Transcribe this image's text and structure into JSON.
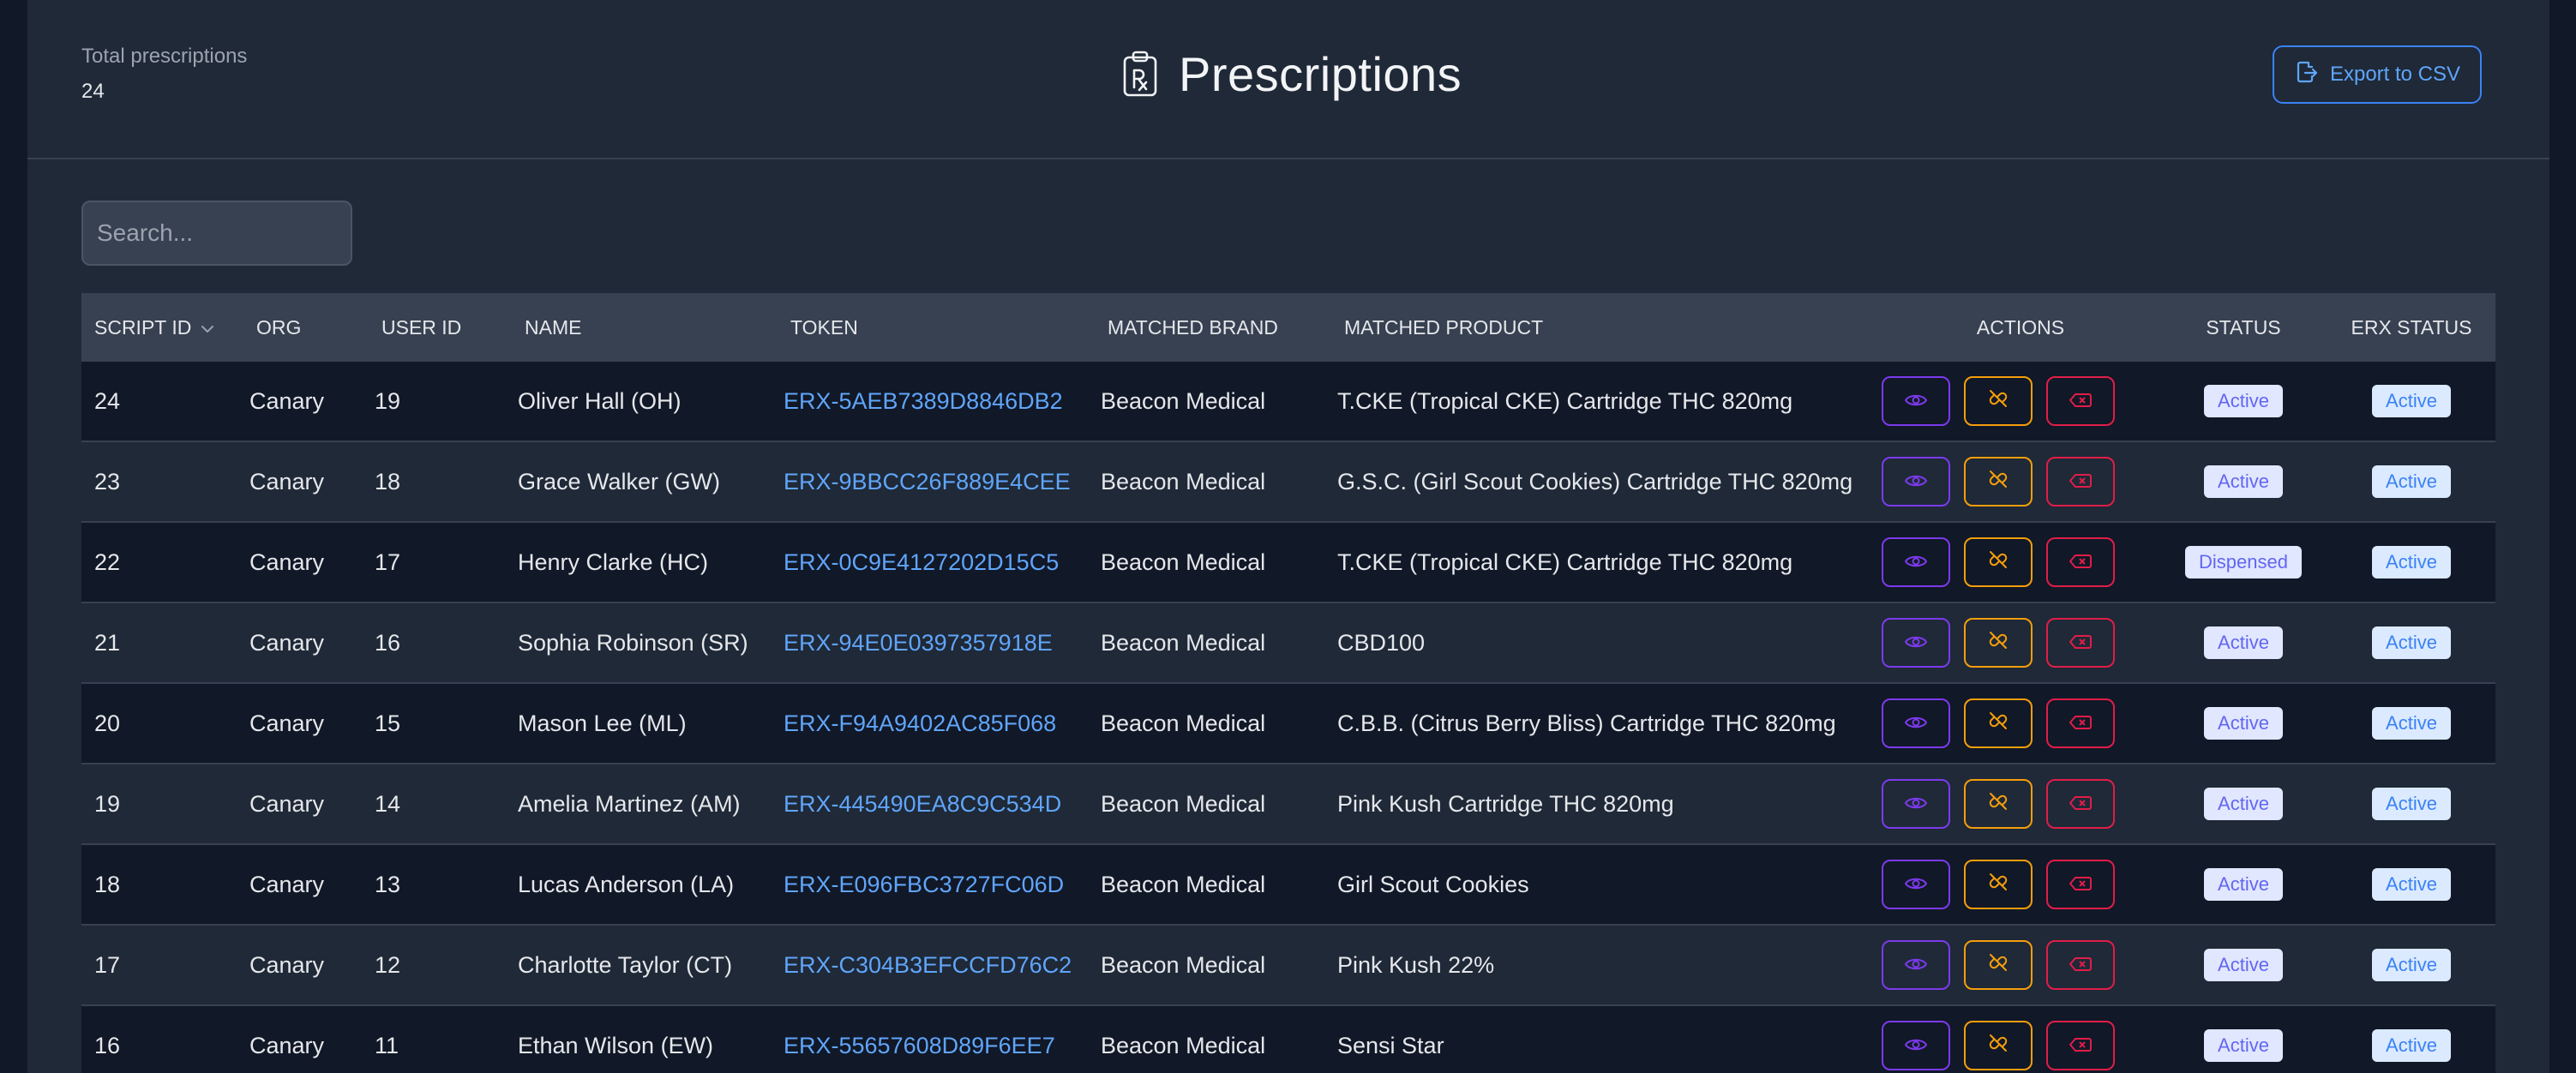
{
  "header": {
    "total_label": "Total prescriptions",
    "total_value": "24",
    "title": "Prescriptions",
    "export_label": "Export to CSV"
  },
  "search": {
    "placeholder": "Search..."
  },
  "table": {
    "columns": {
      "script_id": "SCRIPT ID",
      "org": "ORG",
      "user_id": "USER ID",
      "name": "NAME",
      "token": "TOKEN",
      "brand": "MATCHED BRAND",
      "product": "MATCHED PRODUCT",
      "actions": "ACTIONS",
      "status": "STATUS",
      "erx_status": "ERX STATUS"
    },
    "rows": [
      {
        "id": "24",
        "org": "Canary",
        "user": "19",
        "name": "Oliver Hall (OH)",
        "token": "ERX-5AEB7389D8846DB2",
        "brand": "Beacon Medical",
        "product": "T.CKE (Tropical CKE) Cartridge THC 820mg",
        "status": "Active",
        "erx": "Active"
      },
      {
        "id": "23",
        "org": "Canary",
        "user": "18",
        "name": "Grace Walker (GW)",
        "token": "ERX-9BBCC26F889E4CEE",
        "brand": "Beacon Medical",
        "product": "G.S.C. (Girl Scout Cookies) Cartridge THC 820mg",
        "status": "Active",
        "erx": "Active"
      },
      {
        "id": "22",
        "org": "Canary",
        "user": "17",
        "name": "Henry Clarke (HC)",
        "token": "ERX-0C9E4127202D15C5",
        "brand": "Beacon Medical",
        "product": "T.CKE (Tropical CKE) Cartridge THC 820mg",
        "status": "Dispensed",
        "erx": "Active"
      },
      {
        "id": "21",
        "org": "Canary",
        "user": "16",
        "name": "Sophia Robinson (SR)",
        "token": "ERX-94E0E0397357918E",
        "brand": "Beacon Medical",
        "product": "CBD100",
        "status": "Active",
        "erx": "Active"
      },
      {
        "id": "20",
        "org": "Canary",
        "user": "15",
        "name": "Mason Lee (ML)",
        "token": "ERX-F94A9402AC85F068",
        "brand": "Beacon Medical",
        "product": "C.B.B. (Citrus Berry Bliss) Cartridge THC 820mg",
        "status": "Active",
        "erx": "Active"
      },
      {
        "id": "19",
        "org": "Canary",
        "user": "14",
        "name": "Amelia Martinez (AM)",
        "token": "ERX-445490EA8C9C534D",
        "brand": "Beacon Medical",
        "product": "Pink Kush Cartridge THC 820mg",
        "status": "Active",
        "erx": "Active"
      },
      {
        "id": "18",
        "org": "Canary",
        "user": "13",
        "name": "Lucas Anderson (LA)",
        "token": "ERX-E096FBC3727FC06D",
        "brand": "Beacon Medical",
        "product": "Girl Scout Cookies",
        "status": "Active",
        "erx": "Active"
      },
      {
        "id": "17",
        "org": "Canary",
        "user": "12",
        "name": "Charlotte Taylor (CT)",
        "token": "ERX-C304B3EFCCFD76C2",
        "brand": "Beacon Medical",
        "product": "Pink Kush 22%",
        "status": "Active",
        "erx": "Active"
      },
      {
        "id": "16",
        "org": "Canary",
        "user": "11",
        "name": "Ethan Wilson (EW)",
        "token": "ERX-55657608D89F6EE7",
        "brand": "Beacon Medical",
        "product": "Sensi Star",
        "status": "Active",
        "erx": "Active"
      }
    ]
  },
  "icons": {
    "title": "prescription-clipboard-icon",
    "export": "file-export-icon",
    "sort": "chevron-down-icon",
    "view": "eye-icon",
    "unlink": "unlink-icon",
    "cancel": "cancel-x-icon"
  },
  "colors": {
    "page_bg": "#111827",
    "panel_bg": "#1f2937",
    "header_row": "#374151",
    "link": "#60a5fa",
    "view_border": "#7c3aed",
    "unlink_border": "#f59e0b",
    "cancel_border": "#e11d48"
  }
}
